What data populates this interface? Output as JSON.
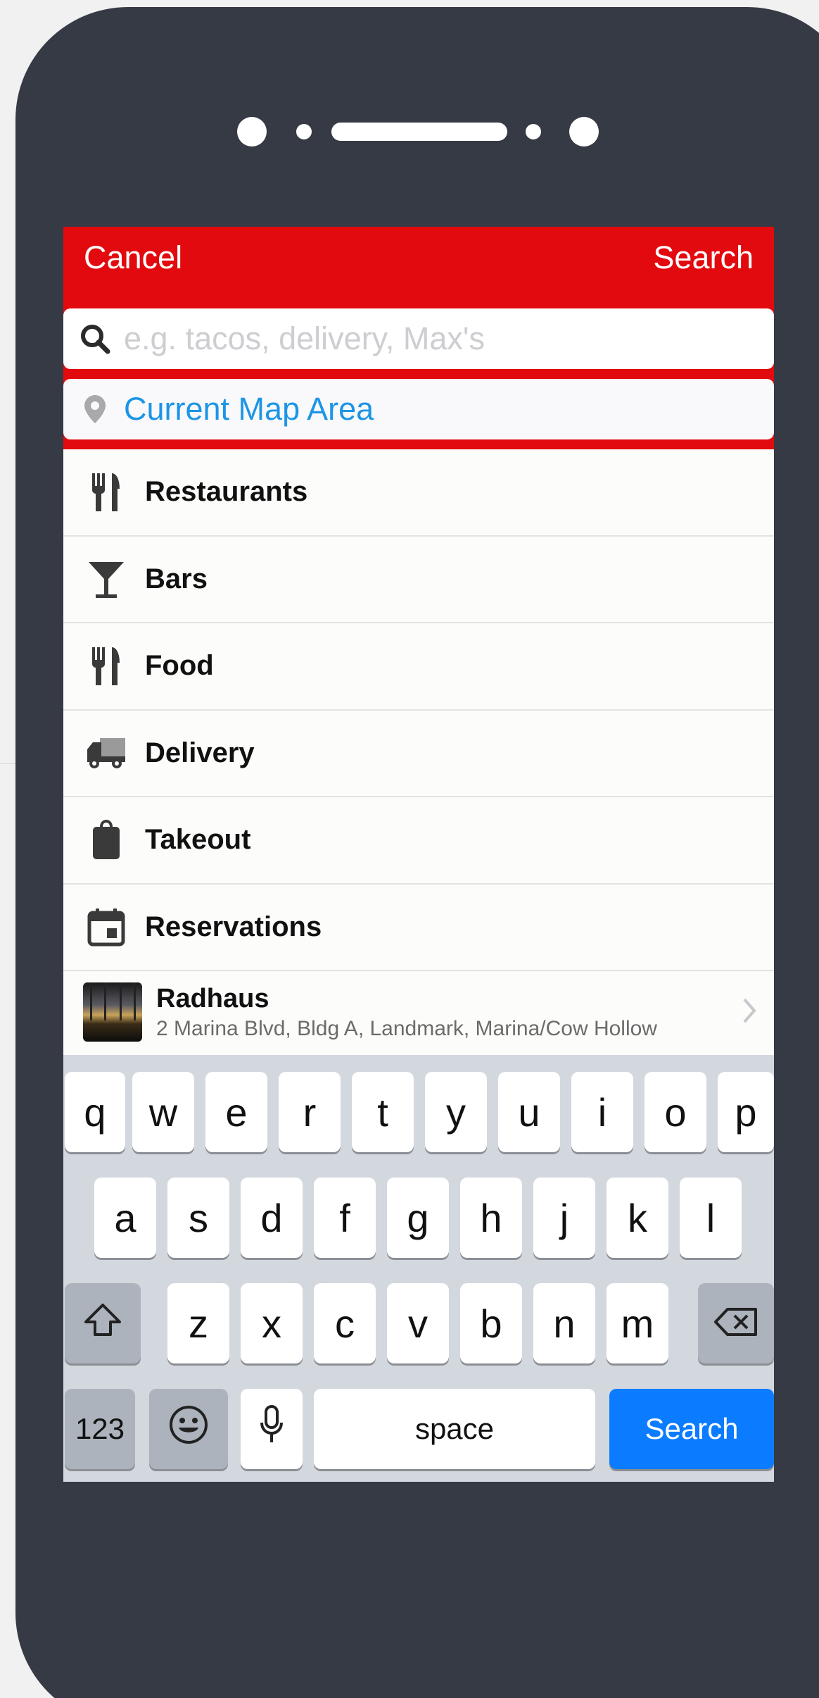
{
  "nav": {
    "cancel_label": "Cancel",
    "search_label": "Search"
  },
  "search": {
    "placeholder": "e.g. tacos, delivery, Max's",
    "value": ""
  },
  "location": {
    "label": "Current Map Area"
  },
  "categories": [
    {
      "label": "Restaurants",
      "icon": "fork-knife-icon"
    },
    {
      "label": "Bars",
      "icon": "cocktail-icon"
    },
    {
      "label": "Food",
      "icon": "fork-knife-icon"
    },
    {
      "label": "Delivery",
      "icon": "delivery-truck-icon"
    },
    {
      "label": "Takeout",
      "icon": "takeout-bag-icon"
    },
    {
      "label": "Reservations",
      "icon": "calendar-icon"
    }
  ],
  "recent": {
    "name": "Radhaus",
    "address": "2 Marina Blvd, Bldg A, Landmark, Marina/Cow Hollow"
  },
  "keyboard": {
    "row1": [
      "q",
      "w",
      "e",
      "r",
      "t",
      "y",
      "u",
      "i",
      "o",
      "p"
    ],
    "row2": [
      "a",
      "s",
      "d",
      "f",
      "g",
      "h",
      "j",
      "k",
      "l"
    ],
    "row3": [
      "z",
      "x",
      "c",
      "v",
      "b",
      "n",
      "m"
    ],
    "numbers_label": "123",
    "space_label": "space",
    "search_label": "Search"
  },
  "colors": {
    "nav_red": "#e20a0e",
    "link_blue": "#1d95e6",
    "key_blue": "#0b7cff",
    "device": "#363a45"
  }
}
